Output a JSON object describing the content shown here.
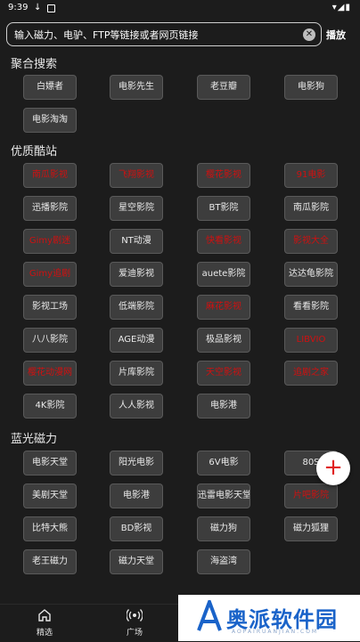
{
  "status_bar": {
    "time": "9:39"
  },
  "search": {
    "placeholder": "输入磁力、电驴、FTP等链接或者网页链接",
    "action_label": "播放"
  },
  "sections": [
    {
      "title": "聚合搜索",
      "buttons": [
        {
          "label": "白嫖者",
          "red": false
        },
        {
          "label": "电影先生",
          "red": false
        },
        {
          "label": "老豆瓣",
          "red": false
        },
        {
          "label": "电影狗",
          "red": false
        },
        {
          "label": "电影淘淘",
          "red": false
        }
      ]
    },
    {
      "title": "优质酷站",
      "buttons": [
        {
          "label": "南瓜影视",
          "red": true
        },
        {
          "label": "飞翔影视",
          "red": true
        },
        {
          "label": "樱花影视",
          "red": true
        },
        {
          "label": "91电影",
          "red": true
        },
        {
          "label": "迅播影院",
          "red": false
        },
        {
          "label": "星空影院",
          "red": false
        },
        {
          "label": "BT影院",
          "red": false
        },
        {
          "label": "南瓜影院",
          "red": false
        },
        {
          "label": "Gimy剧迷",
          "red": true
        },
        {
          "label": "NT动漫",
          "red": false
        },
        {
          "label": "快看影视",
          "red": true
        },
        {
          "label": "影视大全",
          "red": true
        },
        {
          "label": "Gimy追剧",
          "red": true
        },
        {
          "label": "爱迪影视",
          "red": false
        },
        {
          "label": "auete影院",
          "red": false
        },
        {
          "label": "达达龟影院",
          "red": false
        },
        {
          "label": "影视工场",
          "red": false
        },
        {
          "label": "低端影院",
          "red": false
        },
        {
          "label": "麻花影视",
          "red": true
        },
        {
          "label": "看看影院",
          "red": false
        },
        {
          "label": "八八影院",
          "red": false
        },
        {
          "label": "AGE动漫",
          "red": false
        },
        {
          "label": "极品影视",
          "red": false
        },
        {
          "label": "LIBVIO",
          "red": true
        },
        {
          "label": "樱花动漫网",
          "red": true
        },
        {
          "label": "片库影院",
          "red": false
        },
        {
          "label": "天空影视",
          "red": true
        },
        {
          "label": "追剧之家",
          "red": true
        },
        {
          "label": "4K影院",
          "red": false
        },
        {
          "label": "人人影视",
          "red": false
        },
        {
          "label": "电影港",
          "red": false
        }
      ]
    },
    {
      "title": "蓝光磁力",
      "buttons": [
        {
          "label": "电影天堂",
          "red": false
        },
        {
          "label": "阳光电影",
          "red": false
        },
        {
          "label": "6V电影",
          "red": false
        },
        {
          "label": "80S",
          "red": false
        },
        {
          "label": "美剧天堂",
          "red": false
        },
        {
          "label": "电影港",
          "red": false
        },
        {
          "label": "迅雷电影天堂",
          "red": false
        },
        {
          "label": "片吧影院",
          "red": true
        },
        {
          "label": "比特大熊",
          "red": false
        },
        {
          "label": "BD影视",
          "red": false
        },
        {
          "label": "磁力狗",
          "red": false
        },
        {
          "label": "磁力狐狸",
          "red": false
        },
        {
          "label": "老王磁力",
          "red": false
        },
        {
          "label": "磁力天堂",
          "red": false
        },
        {
          "label": "海盗湾",
          "red": false
        }
      ]
    }
  ],
  "bottom_nav": [
    {
      "label": "精选",
      "icon": "home-icon"
    },
    {
      "label": "广场",
      "icon": "broadcast-icon"
    }
  ],
  "watermark": {
    "text": "奥派软件园",
    "url": "AOPAIRUANJIAN.COM"
  },
  "colors": {
    "background": "#1c1c1c",
    "button": "#3d3d3d",
    "highlight_text": "#d01010",
    "fab_plus": "#e02020"
  }
}
